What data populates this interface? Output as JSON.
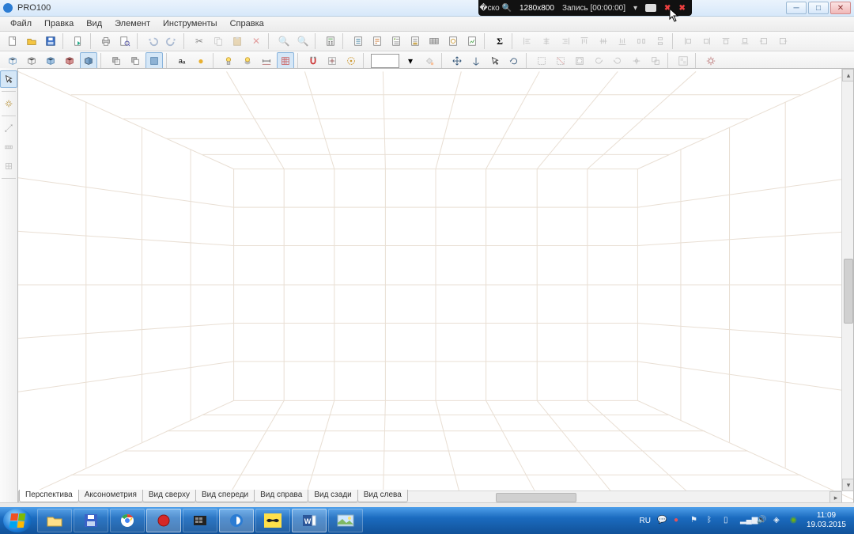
{
  "title": "PRO100",
  "recorder": {
    "resolution": "1280x800",
    "status": "Запись [00:00:00]"
  },
  "menu": [
    "Файл",
    "Правка",
    "Вид",
    "Элемент",
    "Инструменты",
    "Справка"
  ],
  "viewtabs": [
    "Перспектива",
    "Аксонометрия",
    "Вид сверху",
    "Вид спереди",
    "Вид справа",
    "Вид сзади",
    "Вид слева"
  ],
  "active_viewtab": 0,
  "systray": {
    "lang": "RU",
    "time": "11:09",
    "date": "19.03.2015"
  },
  "label_aa": "aₐ",
  "label_sigma": "Σ"
}
